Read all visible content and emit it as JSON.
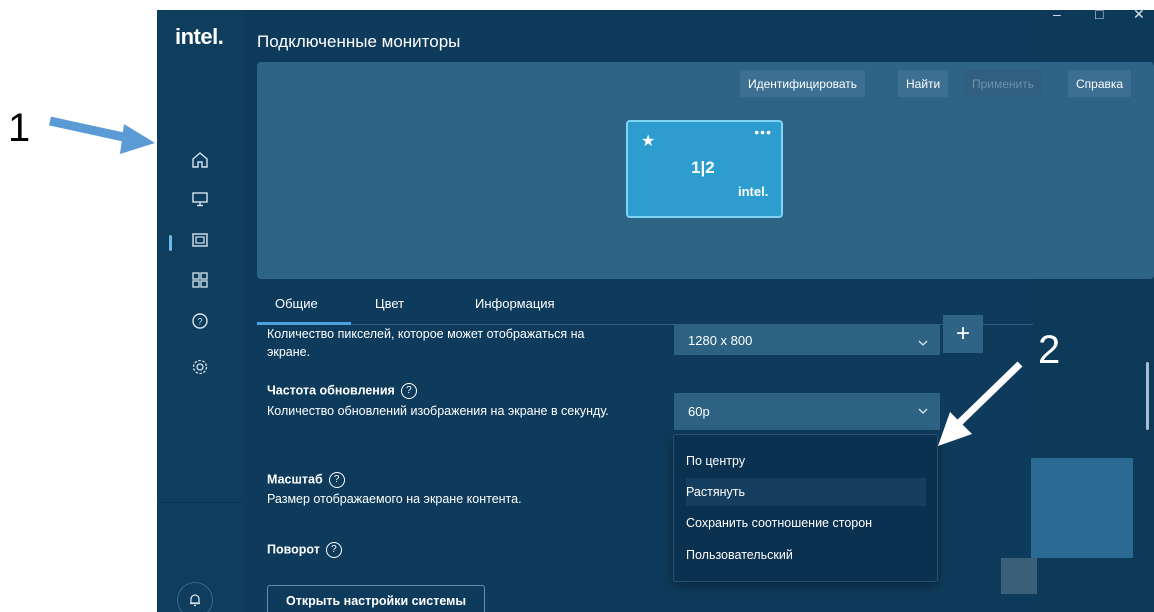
{
  "annotations": {
    "one": "1",
    "two": "2"
  },
  "app": {
    "logo": "intel.",
    "window_controls": {
      "minimize": "–",
      "maximize": "□",
      "close": "✕"
    },
    "title": "Подключенные мониторы"
  },
  "toolbar": {
    "identify": "Идентифицировать",
    "find": "Найти",
    "apply": "Применить",
    "help": "Справка"
  },
  "display_card": {
    "number": "1|2",
    "logo": "intel."
  },
  "sidebar": {
    "items": [
      {
        "icon": "home-icon"
      },
      {
        "icon": "monitor-icon",
        "active": true
      },
      {
        "icon": "media-icon"
      },
      {
        "icon": "apps-grid-icon"
      },
      {
        "icon": "help-icon"
      },
      {
        "icon": "gear-icon"
      }
    ],
    "bell_icon": "bell-icon"
  },
  "tabs": [
    "Общие",
    "Цвет",
    "Информация"
  ],
  "settings": {
    "resolution": {
      "description": "Количество пикселей, которое может отображаться на экране.",
      "value": "1280 x 800",
      "plus": "+"
    },
    "refresh": {
      "label": "Частота обновления",
      "description": "Количество обновлений изображения на экране в секунду.",
      "value": "60p"
    },
    "scale": {
      "label": "Масштаб",
      "description": "Размер отображаемого на экране контента."
    },
    "rotation": {
      "label": "Поворот"
    },
    "help_glyph": "?"
  },
  "dropdown_options": [
    "По центру",
    "Растянуть",
    "Сохранить соотношение сторон",
    "Пользовательский"
  ],
  "dropdown_selected": "Растянуть",
  "open_settings_button": "Открыть настройки системы",
  "colors": {
    "accent": "#2d9ccf",
    "panel": "#0e3b5b",
    "annotation_arrow": "#5b9bd5"
  }
}
